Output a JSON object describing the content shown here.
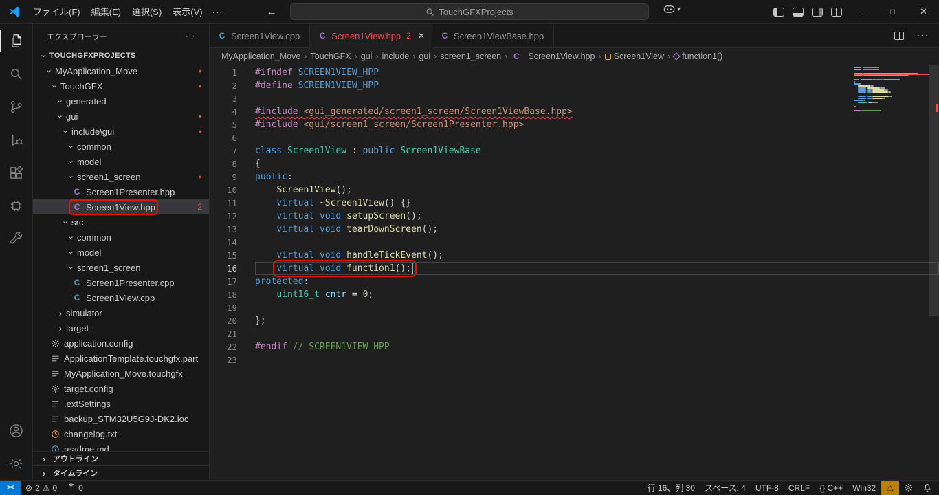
{
  "colors": {
    "accent": "#0078d4",
    "error": "#f14c4c",
    "warning": "#bb8009",
    "annotation": "#e51400",
    "modified_dot": "#c74e39"
  },
  "icons": {
    "chevron": "›",
    "chevron-right": "›",
    "chevron-down": "▾",
    "more": "···",
    "back": "←",
    "forward": "→",
    "minimize": "─",
    "maximize": "□",
    "close": "✕",
    "dot": "●",
    "error": "⊘",
    "warning": "⚠",
    "remote": "><"
  },
  "title_bar": {
    "menus": [
      "ファイル(F)",
      "編集(E)",
      "選択(S)",
      "表示(V)"
    ],
    "search_text": "TouchGFXProjects"
  },
  "activity_bar": {
    "items": [
      "explorer",
      "search",
      "source-control",
      "run-and-debug",
      "extensions",
      "stm32-extension",
      "touchgfx-extension",
      "accounts",
      "settings"
    ]
  },
  "sidebar": {
    "title": "エクスプローラー",
    "bottom_sections": [
      "アウトライン",
      "タイムライン"
    ],
    "tree": [
      {
        "label": "TOUCHGFXPROJECTS",
        "level": 0,
        "kind": "root",
        "chev": "down"
      },
      {
        "label": "MyApplication_Move",
        "level": 1,
        "kind": "folder",
        "chev": "down",
        "dot": true
      },
      {
        "label": "TouchGFX",
        "level": 2,
        "kind": "folder",
        "chev": "down",
        "dot": true
      },
      {
        "label": "generated",
        "level": 3,
        "kind": "folder",
        "chev": "down"
      },
      {
        "label": "gui",
        "level": 3,
        "kind": "folder",
        "chev": "down",
        "dot": true
      },
      {
        "label": "include\\gui",
        "level": 4,
        "kind": "folder",
        "chev": "down",
        "dot": true
      },
      {
        "label": "common",
        "level": 5,
        "kind": "folder",
        "chev": "down"
      },
      {
        "label": "model",
        "level": 5,
        "kind": "folder",
        "chev": "down"
      },
      {
        "label": "screen1_screen",
        "level": 5,
        "kind": "folder",
        "chev": "down",
        "dot": true
      },
      {
        "label": "Screen1Presenter.hpp",
        "level": 6,
        "kind": "file",
        "icon": "hpp"
      },
      {
        "label": "Screen1View.hpp",
        "level": 6,
        "kind": "file",
        "icon": "hpp",
        "badge": "2",
        "selected": true,
        "annotated": true
      },
      {
        "label": "src",
        "level": 4,
        "kind": "folder",
        "chev": "down"
      },
      {
        "label": "common",
        "level": 5,
        "kind": "folder",
        "chev": "down"
      },
      {
        "label": "model",
        "level": 5,
        "kind": "folder",
        "chev": "down"
      },
      {
        "label": "screen1_screen",
        "level": 5,
        "kind": "folder",
        "chev": "down"
      },
      {
        "label": "Screen1Presenter.cpp",
        "level": 6,
        "kind": "file",
        "icon": "cpp"
      },
      {
        "label": "Screen1View.cpp",
        "level": 6,
        "kind": "file",
        "icon": "cpp"
      },
      {
        "label": "simulator",
        "level": 3,
        "kind": "folder",
        "chev": "right"
      },
      {
        "label": "target",
        "level": 3,
        "kind": "folder",
        "chev": "right"
      },
      {
        "label": "application.config",
        "level": 2,
        "kind": "file",
        "icon": "config"
      },
      {
        "label": "ApplicationTemplate.touchgfx.part",
        "level": 2,
        "kind": "file",
        "icon": "list"
      },
      {
        "label": "MyApplication_Move.touchgfx",
        "level": 2,
        "kind": "file",
        "icon": "list"
      },
      {
        "label": "target.config",
        "level": 2,
        "kind": "file",
        "icon": "config"
      },
      {
        "label": ".extSettings",
        "level": 2,
        "kind": "file",
        "icon": "list"
      },
      {
        "label": "backup_STM32U5G9J-DK2.ioc",
        "level": 2,
        "kind": "file",
        "icon": "list"
      },
      {
        "label": "changelog.txt",
        "level": 2,
        "kind": "file",
        "icon": "clock"
      },
      {
        "label": "readme.md",
        "level": 2,
        "kind": "file",
        "icon": "info"
      }
    ]
  },
  "tabs": [
    {
      "label": "Screen1View.cpp",
      "icon": "cpp",
      "active": false
    },
    {
      "label": "Screen1View.hpp",
      "icon": "hpp",
      "active": true,
      "error": true,
      "badge": "2"
    },
    {
      "label": "Screen1ViewBase.hpp",
      "icon": "hpp",
      "active": false
    }
  ],
  "breadcrumbs": [
    {
      "label": "MyApplication_Move"
    },
    {
      "label": "TouchGFX"
    },
    {
      "label": "gui"
    },
    {
      "label": "include"
    },
    {
      "label": "gui"
    },
    {
      "label": "screen1_screen"
    },
    {
      "label": "Screen1View.hpp",
      "icon": "hpp"
    },
    {
      "label": "Screen1View",
      "icon": "class"
    },
    {
      "label": "function1()",
      "icon": "method"
    }
  ],
  "code": {
    "lines": [
      {
        "n": 1,
        "tokens": [
          [
            "pp",
            "#ifndef"
          ],
          [
            "pl",
            " "
          ],
          [
            "mac",
            "SCREEN1VIEW_HPP"
          ]
        ]
      },
      {
        "n": 2,
        "tokens": [
          [
            "pp",
            "#define"
          ],
          [
            "pl",
            " "
          ],
          [
            "mac",
            "SCREEN1VIEW_HPP"
          ]
        ]
      },
      {
        "n": 3,
        "tokens": []
      },
      {
        "n": 4,
        "err": true,
        "tokens": [
          [
            "pp",
            "#include"
          ],
          [
            "pl",
            " "
          ],
          [
            "str",
            "<gui_generated/screen1_screen/Screen1ViewBase.hpp>"
          ]
        ]
      },
      {
        "n": 5,
        "tokens": [
          [
            "pp",
            "#include"
          ],
          [
            "pl",
            " "
          ],
          [
            "str",
            "<gui/screen1_screen/Screen1Presenter.hpp>"
          ]
        ]
      },
      {
        "n": 6,
        "tokens": []
      },
      {
        "n": 7,
        "tokens": [
          [
            "kw",
            "class"
          ],
          [
            "pl",
            " "
          ],
          [
            "typ",
            "Screen1View"
          ],
          [
            "pl",
            " : "
          ],
          [
            "kw",
            "public"
          ],
          [
            "pl",
            " "
          ],
          [
            "typ",
            "Screen1ViewBase"
          ]
        ]
      },
      {
        "n": 8,
        "tokens": [
          [
            "pl",
            "{"
          ]
        ]
      },
      {
        "n": 9,
        "tokens": [
          [
            "kw",
            "public"
          ],
          [
            "pl",
            ":"
          ]
        ]
      },
      {
        "n": 10,
        "tokens": [
          [
            "pl",
            "    "
          ],
          [
            "fn",
            "Screen1View"
          ],
          [
            "pl",
            "();"
          ]
        ]
      },
      {
        "n": 11,
        "tokens": [
          [
            "pl",
            "    "
          ],
          [
            "kw",
            "virtual"
          ],
          [
            "pl",
            " "
          ],
          [
            "fn",
            "~Screen1View"
          ],
          [
            "pl",
            "() {}"
          ]
        ]
      },
      {
        "n": 12,
        "tokens": [
          [
            "pl",
            "    "
          ],
          [
            "kw",
            "virtual"
          ],
          [
            "pl",
            " "
          ],
          [
            "kw",
            "void"
          ],
          [
            "pl",
            " "
          ],
          [
            "fn",
            "setupScreen"
          ],
          [
            "pl",
            "();"
          ]
        ]
      },
      {
        "n": 13,
        "tokens": [
          [
            "pl",
            "    "
          ],
          [
            "kw",
            "virtual"
          ],
          [
            "pl",
            " "
          ],
          [
            "kw",
            "void"
          ],
          [
            "pl",
            " "
          ],
          [
            "fn",
            "tearDownScreen"
          ],
          [
            "pl",
            "();"
          ]
        ]
      },
      {
        "n": 14,
        "tokens": []
      },
      {
        "n": 15,
        "tokens": [
          [
            "pl",
            "    "
          ],
          [
            "kw",
            "virtual"
          ],
          [
            "pl",
            " "
          ],
          [
            "kw",
            "void"
          ],
          [
            "pl",
            " "
          ],
          [
            "fn",
            "handleTickEvent"
          ],
          [
            "pl",
            "();"
          ]
        ]
      },
      {
        "n": 16,
        "cur": true,
        "ann": true,
        "tokens": [
          [
            "pl",
            "    "
          ],
          [
            "kw",
            "virtual"
          ],
          [
            "pl",
            " "
          ],
          [
            "kw",
            "void"
          ],
          [
            "pl",
            " "
          ],
          [
            "fn",
            "function1"
          ],
          [
            "pl",
            "();"
          ]
        ]
      },
      {
        "n": 17,
        "tokens": [
          [
            "kw",
            "protected"
          ],
          [
            "pl",
            ":"
          ]
        ]
      },
      {
        "n": 18,
        "tokens": [
          [
            "pl",
            "    "
          ],
          [
            "typ",
            "uint16_t"
          ],
          [
            "pl",
            " "
          ],
          [
            "var",
            "cntr"
          ],
          [
            "pl",
            " = "
          ],
          [
            "num",
            "0"
          ],
          [
            "pl",
            ";"
          ]
        ]
      },
      {
        "n": 19,
        "tokens": []
      },
      {
        "n": 20,
        "tokens": [
          [
            "pl",
            "};"
          ]
        ]
      },
      {
        "n": 21,
        "tokens": []
      },
      {
        "n": 22,
        "tokens": [
          [
            "pp",
            "#endif"
          ],
          [
            "pl",
            " "
          ],
          [
            "cmt",
            "// SCREEN1VIEW_HPP"
          ]
        ]
      },
      {
        "n": 23,
        "tokens": []
      }
    ]
  },
  "status_bar": {
    "errors": "2",
    "warnings": "0",
    "ports": "0",
    "right_items": [
      "行 16、列 30",
      "スペース: 4",
      "UTF-8",
      "CRLF",
      "{} C++",
      "Win32"
    ]
  }
}
